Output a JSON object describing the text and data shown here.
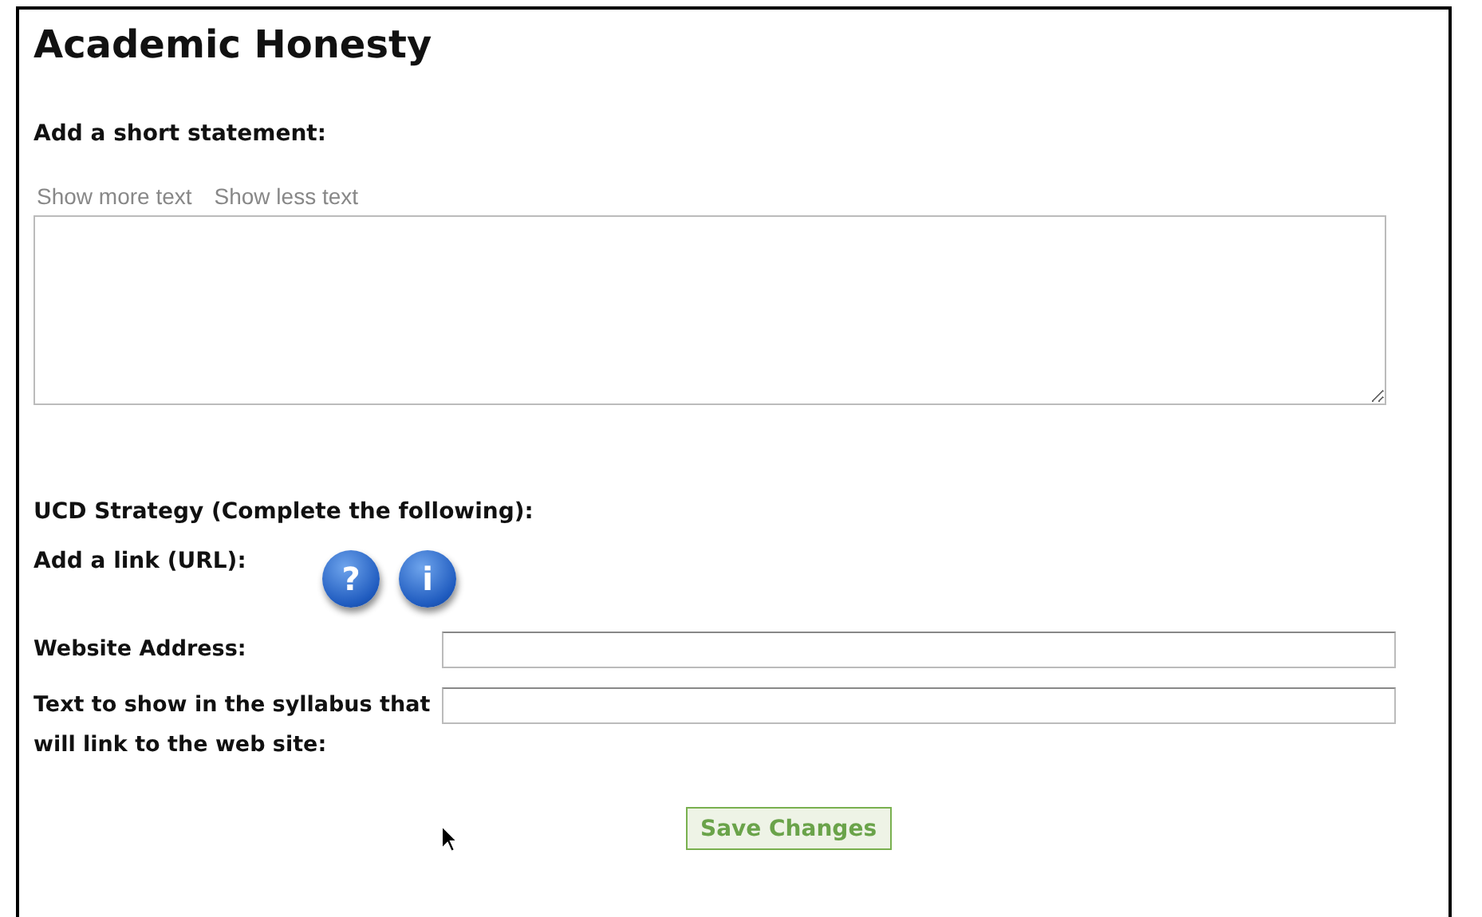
{
  "title": "Academic Honesty",
  "statement": {
    "heading": "Add a short statement:",
    "links": [
      "Show more text",
      "Show less text"
    ]
  },
  "strategy": {
    "heading": "UCD Strategy (Complete the following):",
    "link_label": "Add a link (URL):",
    "help_icons": [
      "?",
      "i"
    ]
  },
  "fields": [
    {
      "label": "Website Address:"
    },
    {
      "label": "Text to show in the syllabus that will link to the web site:"
    }
  ],
  "save_button": "Save Changes"
}
